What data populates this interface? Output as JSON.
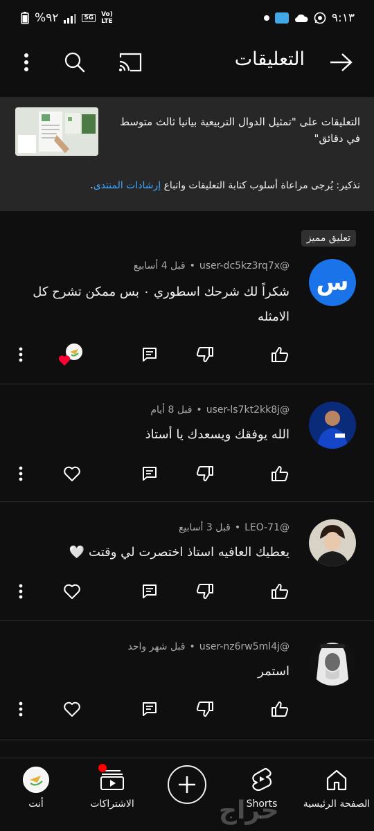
{
  "status_bar": {
    "time": "٩:١٣",
    "battery": "%٩٢",
    "net_5g": "5G",
    "volte": "Vo) LTE"
  },
  "header": {
    "title": "التعليقات"
  },
  "video": {
    "caption": "التعليقات على \"تمثيل الدوال التربيعية بيانيا ثالث متوسط في دقائق\"",
    "reminder_text": "تذكير: يُرجى مراعاة أسلوب كتابة التعليقات واتباع ",
    "reminder_link": "إرشادات المنتدى",
    "reminder_end": "."
  },
  "featured_badge": "تعليق مميز",
  "comments": [
    {
      "author": "@user-dc5kz3rq7x",
      "time": "قبل 4 أسابيع",
      "text": "شكراً لك شرحك اسطوري ٠ بس ممكن تشرح كل الامثله",
      "avatar_letter": "س",
      "avatar_color": "#1a73e8"
    },
    {
      "author": "@user-ls7kt2kk8j",
      "time": "قبل 8 أيام",
      "text": "الله يوفقك ويسعدك يا أستاذ"
    },
    {
      "author": "@LEO-71",
      "time": "قبل 3 أسابيع",
      "text": "يعطيك العافيه استاذ اختصرت لي وقتت 🤍"
    },
    {
      "author": "@user-nz6rw5ml4j",
      "time": "قبل شهر واحد",
      "text": "استمر"
    }
  ],
  "bottom_nav": {
    "home": "الصفحة الرئيسية",
    "shorts": "Shorts",
    "subscriptions": "الاشتراكات",
    "you": "أنت"
  },
  "watermark": "حراج",
  "icons": [
    "back-arrow-icon",
    "cast-icon",
    "search-icon",
    "more-vert-icon",
    "like-icon",
    "dislike-icon",
    "reply-icon",
    "heart-icon",
    "home-icon",
    "shorts-icon",
    "create-icon",
    "subscriptions-icon"
  ]
}
